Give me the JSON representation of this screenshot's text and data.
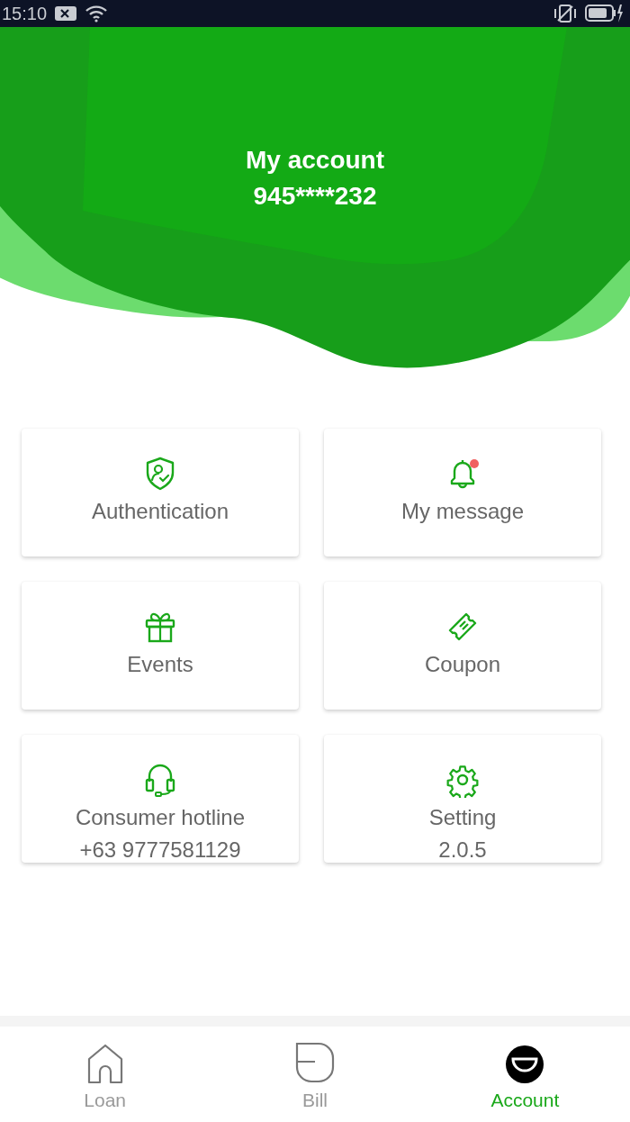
{
  "status_bar": {
    "time": "15:10"
  },
  "header": {
    "title": "My account",
    "account_number": "945****232"
  },
  "menu_cards": [
    {
      "label": "Authentication"
    },
    {
      "label": "My message",
      "unread": true
    },
    {
      "label": "Events"
    },
    {
      "label": "Coupon"
    },
    {
      "label": "Consumer hotline",
      "detail": "+63 9777581129"
    },
    {
      "label": "Setting",
      "detail": "2.0.5"
    }
  ],
  "bottom_nav": [
    {
      "label": "Loan",
      "selected": false
    },
    {
      "label": "Bill",
      "selected": false
    },
    {
      "label": "Account",
      "selected": true
    }
  ]
}
